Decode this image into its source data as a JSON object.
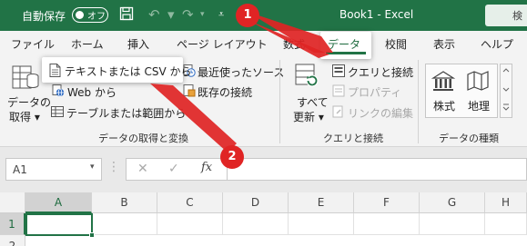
{
  "titlebar": {
    "autosave_label": "自動保存",
    "autosave_state": "オフ",
    "doc_title": "Book1  -  Excel",
    "search_hint": "検"
  },
  "tabs": [
    {
      "label": "ファイル"
    },
    {
      "label": "ホーム"
    },
    {
      "label": "挿入"
    },
    {
      "label": "ページ レイアウト"
    },
    {
      "label": "数式"
    },
    {
      "label": "データ"
    },
    {
      "label": "校閲"
    },
    {
      "label": "表示"
    },
    {
      "label": "ヘルプ"
    }
  ],
  "ribbon": {
    "get_data_line1": "データの",
    "get_data_line2": "取得 ▾",
    "from_text_csv": "テキストまたは CSV から",
    "from_web": "Web から",
    "from_table": "テーブルまたは範囲から",
    "recent_sources": "最近使ったソース",
    "existing_connections": "既存の接続",
    "group_get_transform": "データの取得と変換",
    "refresh_all_line1": "すべて",
    "refresh_all_line2": "更新 ▾",
    "queries_connections": "クエリと接続",
    "properties": "プロパティ",
    "edit_links": "リンクの編集",
    "group_queries": "クエリと接続",
    "stocks": "株式",
    "geography": "地理",
    "group_data_types": "データの種類"
  },
  "formula_bar": {
    "name_box": "A1",
    "fx": "fx"
  },
  "grid": {
    "columns": [
      "A",
      "B",
      "C",
      "D",
      "E",
      "F",
      "G",
      "H"
    ],
    "rows": [
      "1",
      "2"
    ]
  },
  "annotations": {
    "badge1": "1",
    "badge2": "2",
    "color": "#e02424"
  },
  "colors": {
    "excel_green": "#217346",
    "ribbon_bg": "#f3f3f3"
  }
}
